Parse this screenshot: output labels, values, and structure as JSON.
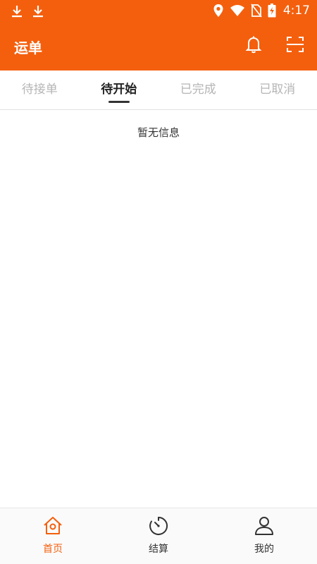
{
  "status_bar": {
    "time": "4:17",
    "left_icons": [
      "download-icon",
      "download-icon"
    ],
    "right_icons": [
      "location-icon",
      "wifi-icon",
      "no-sim-icon",
      "battery-charging-icon"
    ]
  },
  "header": {
    "title": "运单",
    "icons": [
      "bell-icon",
      "scan-icon"
    ]
  },
  "tabs": [
    {
      "label": "待接单",
      "active": false
    },
    {
      "label": "待开始",
      "active": true
    },
    {
      "label": "已完成",
      "active": false
    },
    {
      "label": "已取消",
      "active": false
    }
  ],
  "content": {
    "empty_text": "暂无信息"
  },
  "bottom_nav": [
    {
      "label": "首页",
      "icon": "home-icon",
      "active": true
    },
    {
      "label": "结算",
      "icon": "timer-icon",
      "active": false
    },
    {
      "label": "我的",
      "icon": "user-icon",
      "active": false
    }
  ],
  "colors": {
    "accent": "#f45f0d",
    "tab_inactive": "#b5b5b5",
    "tab_active": "#222222",
    "text": "#333333"
  }
}
